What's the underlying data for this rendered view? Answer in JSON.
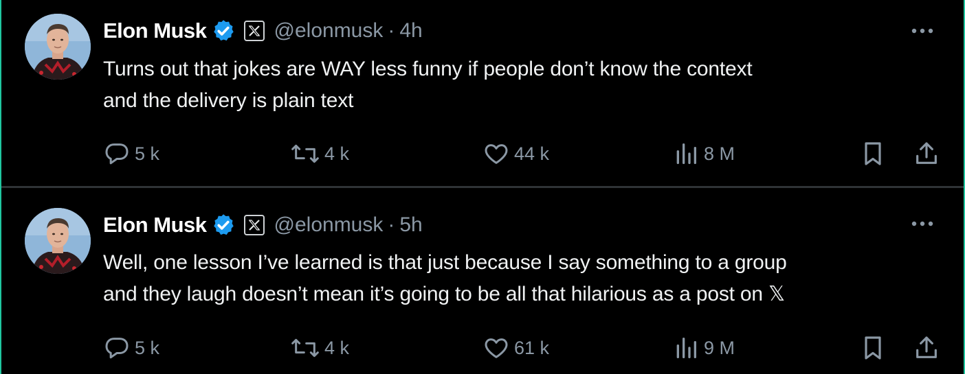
{
  "tweets": [
    {
      "author": "Elon Musk",
      "handle": "@elonmusk",
      "separator": "·",
      "time": "4h",
      "text_lines": [
        "Turns out that jokes are WAY less funny if people don’t know the context",
        "and the delivery is plain text"
      ],
      "replies": "5 k",
      "reposts": "4 k",
      "likes": "44 k",
      "views": "8 M"
    },
    {
      "author": "Elon Musk",
      "handle": "@elonmusk",
      "separator": "·",
      "time": "5h",
      "text_lines": [
        "Well, one lesson I’ve learned is that just because I say something to a group",
        "and they laugh doesn’t mean it’s going to be all that hilarious as a post on 𝕏"
      ],
      "replies": "5 k",
      "reposts": "4 k",
      "likes": "61 k",
      "views": "9 M"
    }
  ],
  "icons": {
    "verified": "verified-badge-icon",
    "affiliate": "x-logo-icon",
    "more": "more-horizontal-icon",
    "reply": "reply-icon",
    "repost": "repost-icon",
    "like": "heart-icon",
    "views": "views-chart-icon",
    "bookmark": "bookmark-icon",
    "share": "share-icon"
  },
  "colors": {
    "background": "#000000",
    "text": "#e7e9ea",
    "muted": "#8b98a5",
    "verified": "#1d9bf0",
    "divider": "#2f3336",
    "frame_accent": "#1fc7a0"
  }
}
